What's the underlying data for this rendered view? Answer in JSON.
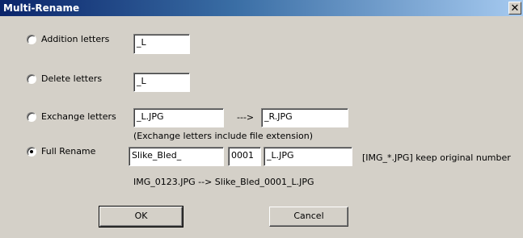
{
  "window": {
    "title": "Multi-Rename",
    "close_glyph": "✕"
  },
  "options": {
    "addition": {
      "label": "Addition letters",
      "value": "_L",
      "checked": false
    },
    "delete": {
      "label": "Delete letters",
      "value": "_L",
      "checked": false
    },
    "exchange": {
      "label": "Exchange letters",
      "from_value": "_L.JPG",
      "arrow": "--->",
      "to_value": "_R.JPG",
      "note": "(Exchange letters include file extension)",
      "checked": false
    },
    "full_rename": {
      "label": "Full Rename",
      "prefix_value": "Slike_Bled_",
      "number_value": "0001",
      "suffix_value": "_L.JPG",
      "hint": "[IMG_*.JPG] keep original number",
      "example": "IMG_0123.JPG --> Slike_Bled_0001_L.JPG",
      "checked": true
    }
  },
  "buttons": {
    "ok_label": "OK",
    "cancel_label": "Cancel"
  }
}
